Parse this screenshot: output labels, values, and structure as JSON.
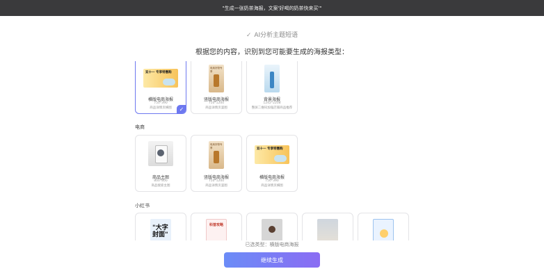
{
  "banner": {
    "text": "\"生成一张奶茶海报，文案'好喝的奶茶快来买'\""
  },
  "status": {
    "text": "AI分析主题短语"
  },
  "heading": "根据您的内容，识别到您可能要生成的海报类型：",
  "groups": [
    {
      "title": "",
      "cards": [
        {
          "name": "横版电商海报",
          "size": "750*390",
          "desc": "商品详情页横图",
          "thumb_text": "双十一 专享特惠购",
          "selected": true
        },
        {
          "name": "竖版电商海报",
          "size": "750*1200",
          "desc": "商品详情页竖图",
          "thumb_text": "电商好物专享"
        },
        {
          "name": "背景海报",
          "size": "1242*2208",
          "desc": "整屏二维码加强店铺商品推荐",
          "thumb_text": ""
        }
      ]
    },
    {
      "title": "电商",
      "cards": [
        {
          "name": "商品主图",
          "size": "800*800",
          "desc": "商品搜索主图",
          "thumb_text": ""
        },
        {
          "name": "竖版电商海报",
          "size": "750*1200",
          "desc": "商品详情页竖图",
          "thumb_text": "电商好物专享"
        },
        {
          "name": "横版电商海报",
          "size": "750*390",
          "desc": "商品详情页横图",
          "thumb_text": "双十一 专享特惠购"
        }
      ]
    },
    {
      "title": "小红书",
      "cards": [
        {
          "thumb_text": "\"大字 封面\""
        },
        {
          "thumb_text": "科普攻略"
        },
        {
          "thumb_text": ""
        },
        {
          "thumb_text": ""
        },
        {
          "thumb_text": ""
        },
        {
          "thumb_text": ""
        }
      ]
    }
  ],
  "selected_line": "已选类型：横版电商海报",
  "cta": "继续生成",
  "colors": {
    "accent": "#6d78f0",
    "topbar": "#3a3a3c"
  }
}
